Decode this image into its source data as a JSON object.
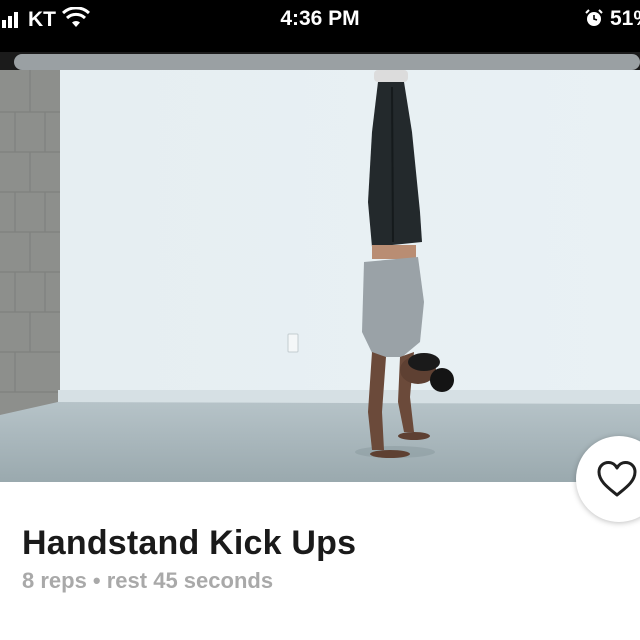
{
  "status_bar": {
    "carrier": "KT",
    "time": "4:36 PM",
    "battery": "51%"
  },
  "video": {
    "icon": "handstand-video-frame"
  },
  "exercise": {
    "title": "Handstand Kick Ups",
    "meta": "8 reps • rest 45 seconds"
  },
  "favorite": {
    "icon": "heart-icon"
  },
  "colors": {
    "title": "#1a1a1a",
    "meta": "#a9a9a9",
    "status_bar_bg": "#000000"
  }
}
